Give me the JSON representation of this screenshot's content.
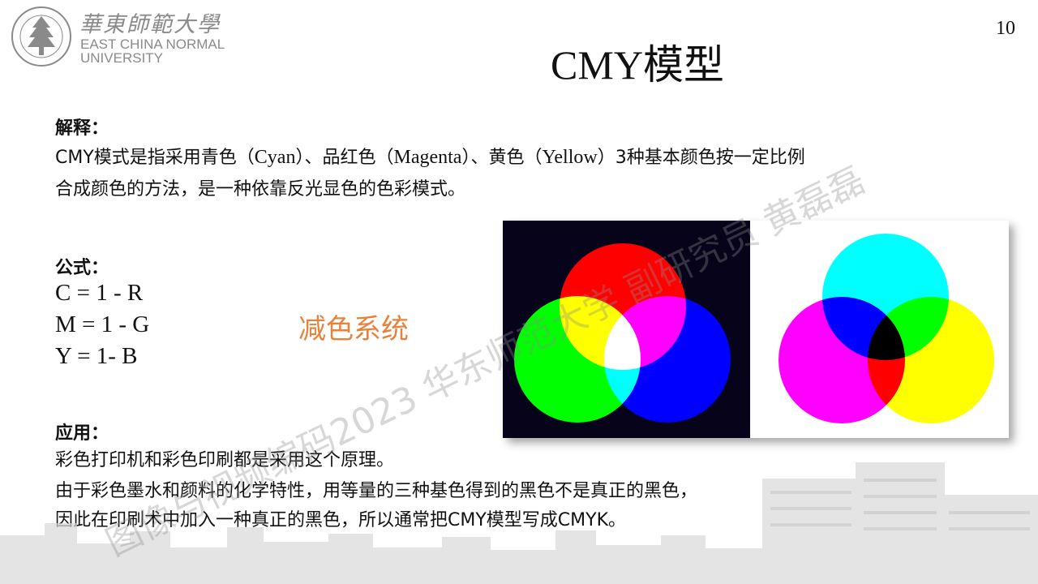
{
  "header": {
    "logo_cn": "華東師範大學",
    "logo_en_line1": "EAST CHINA NORMAL",
    "logo_en_line2": "UNIVERSITY",
    "page_number": "10"
  },
  "title": "CMY模型",
  "explanation": {
    "heading": "解释：",
    "line1_parts": [
      "CMY模式是指采用青色（",
      "Cyan",
      "）、品红色（",
      "Magenta",
      "）、黄色（",
      "Yellow",
      "）3种基本颜色按一定比例"
    ],
    "line2": "合成颜色的方法，是一种依靠反光显色的色彩模式。"
  },
  "formula": {
    "heading": "公式：",
    "lines": [
      "C = 1 - R",
      "M = 1 - G",
      "Y = 1- B"
    ]
  },
  "subtractive_label": "减色系统",
  "application": {
    "heading": "应用：",
    "lines": [
      "彩色打印机和彩色印刷都是采用这个原理。",
      "由于彩色墨水和颜料的化学特性，用等量的三种基色得到的黑色不是真正的黑色，",
      "因此在印刷术中加入一种真正的黑色，所以通常把CMY模型写成CMYK。"
    ]
  },
  "figure": {
    "left_panel": "additive RGB circles on dark background",
    "right_panel": "subtractive CMY circles on white background"
  },
  "colors": {
    "accent_orange": "#e8813a",
    "logo_gray": "#8a8a8a",
    "rgb_bg": "#07031a",
    "red": "#ff0000",
    "green": "#00ff00",
    "blue": "#0000ff",
    "cyan": "#00ffff",
    "magenta": "#ff00ff",
    "yellow": "#ffff00"
  },
  "watermark": "图像与视频编码2023 华东师范大学 副研究员 黄磊磊"
}
